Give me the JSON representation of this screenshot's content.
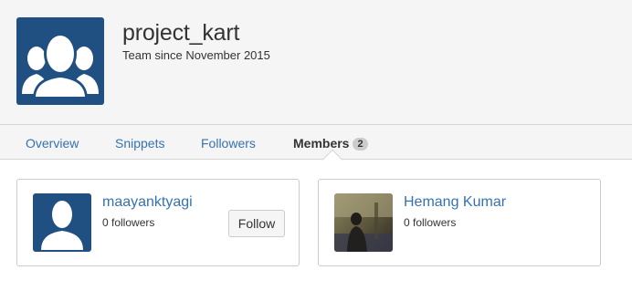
{
  "team": {
    "name": "project_kart",
    "since": "Team since November 2015"
  },
  "tabs": [
    {
      "label": "Overview",
      "active": false
    },
    {
      "label": "Snippets",
      "active": false
    },
    {
      "label": "Followers",
      "active": false
    },
    {
      "label": "Members",
      "active": true,
      "badge": "2"
    }
  ],
  "members": [
    {
      "name": "maayanktyagi",
      "followers": "0 followers",
      "avatar": "default-user-icon",
      "follow_label": "Follow"
    },
    {
      "name": "Hemang Kumar",
      "followers": "0 followers",
      "avatar": "user-photo"
    }
  ],
  "colors": {
    "brand": "#205081",
    "link": "#3572b0",
    "header_bg": "#f5f5f5",
    "border": "#cccccc"
  }
}
